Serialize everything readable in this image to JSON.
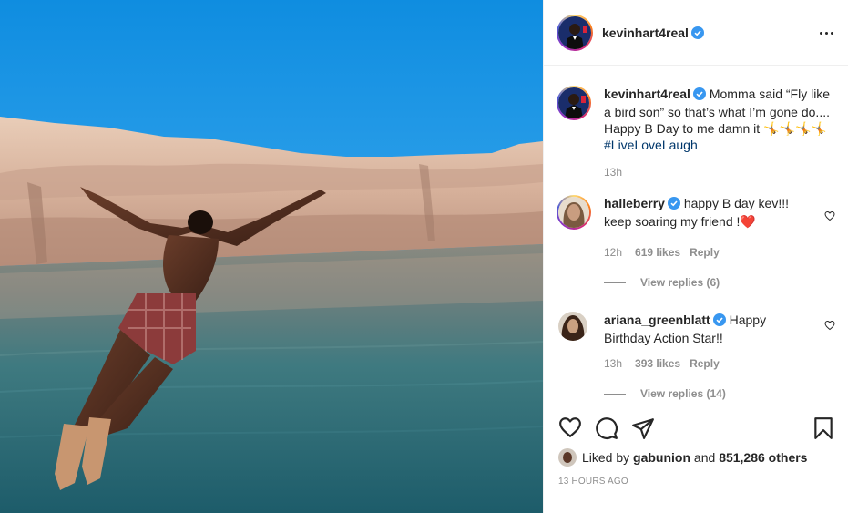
{
  "post": {
    "author": "kevinhart4real",
    "caption": "Momma said “Fly like a bird son” so that’s what I’m gone do.... Happy B Day to me damn it ",
    "caption_emojis": "🤸🤸🤸🤸",
    "hashtag": "#LiveLoveLaugh",
    "caption_time": "13h"
  },
  "comments": [
    {
      "username": "halleberry",
      "text": "happy B day kev!!! keep soaring my friend !",
      "emoji": "❤️",
      "time": "12h",
      "likes": "619 likes",
      "reply": "Reply",
      "view_replies": "View replies (6)"
    },
    {
      "username": "ariana_greenblatt",
      "text": "Happy Birthday Action Star!!",
      "time": "13h",
      "likes": "393 likes",
      "reply": "Reply",
      "view_replies": "View replies (14)"
    }
  ],
  "likes_bar": {
    "prefix": "Liked by ",
    "liker": "gabunion",
    "middle": " and ",
    "others": "851,286 others"
  },
  "timestamp": "13 HOURS AGO",
  "icons": {
    "more": "more-options-icon",
    "verified": "verified-badge-icon",
    "like": "heart-icon",
    "comment": "comment-icon",
    "share": "share-icon",
    "save": "bookmark-icon"
  },
  "colors": {
    "verified": "#3897f0",
    "link": "#00376b",
    "muted": "#8e8e8e",
    "heart_emoji": "#ed4956"
  }
}
